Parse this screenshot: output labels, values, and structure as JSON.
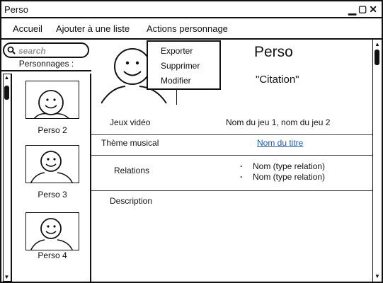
{
  "window": {
    "title": "Perso",
    "controls": [
      "minimize-icon",
      "maximize-icon",
      "close-icon"
    ]
  },
  "menu": {
    "items": [
      "Accueil",
      "Ajouter à une liste",
      "Actions personnage"
    ],
    "dropdown": [
      "Exporter",
      "Supprimer",
      "Modifier"
    ]
  },
  "sidebar": {
    "search_placeholder": "search",
    "header": "Personnages :",
    "items": [
      {
        "label": "Perso 2",
        "icon": "face-icon"
      },
      {
        "label": "Perso 3",
        "icon": "face-icon"
      },
      {
        "label": "Perso 4",
        "icon": "face-icon"
      }
    ]
  },
  "detail": {
    "name": "Perso",
    "quote": "\"Citation\"",
    "avatar_icon": "face-icon",
    "games_label": "Jeux vidéo",
    "games_value": "Nom du jeu 1, nom du jeu 2",
    "theme_label": "Thème musical",
    "theme_value": "Nom du titre",
    "relations_label": "Relations",
    "relations": [
      "Nom (type relation)",
      "Nom (type relation)"
    ],
    "description_label": "Description"
  },
  "colors": {
    "link": "#1a5bbf",
    "border": "#111111"
  }
}
